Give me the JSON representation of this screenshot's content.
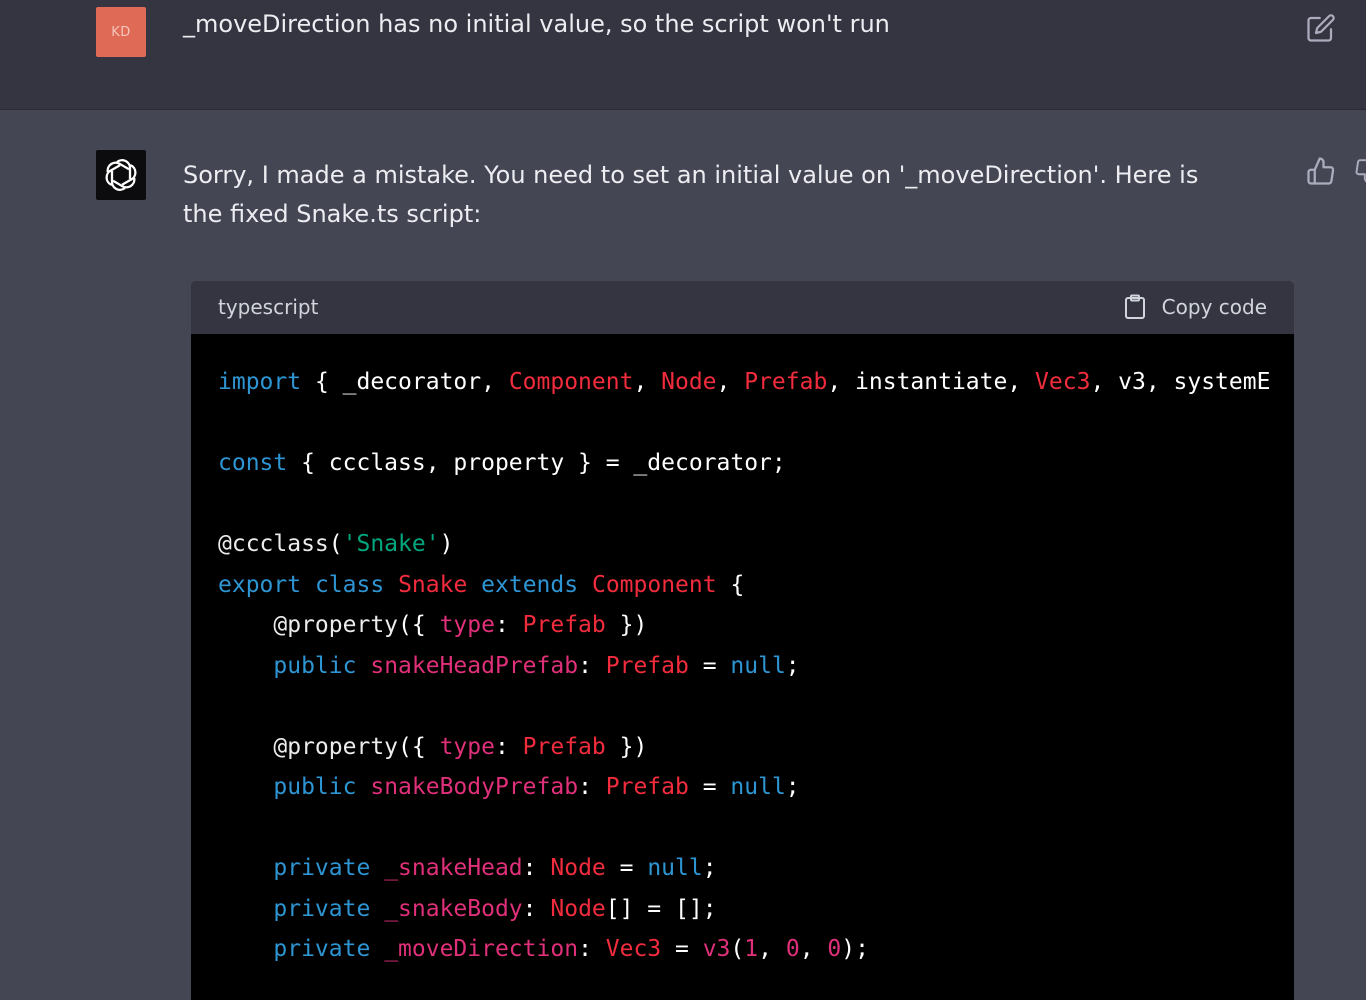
{
  "user_message": {
    "avatar_initials": "KD",
    "text": "_moveDirection has no initial value, so the script won't run"
  },
  "assistant_message": {
    "text": "Sorry, I made a mistake. You need to set an initial value on '_moveDirection'. Here is the fixed Snake.ts script:"
  },
  "code_block": {
    "language": "typescript",
    "copy_label": "Copy code",
    "lines": [
      [
        [
          "kw",
          "import"
        ],
        [
          "pl",
          " { _decorator, "
        ],
        [
          "ty",
          "Component"
        ],
        [
          "pl",
          ", "
        ],
        [
          "ty",
          "Node"
        ],
        [
          "pl",
          ", "
        ],
        [
          "ty",
          "Prefab"
        ],
        [
          "pl",
          ", instantiate, "
        ],
        [
          "ty",
          "Vec3"
        ],
        [
          "pl",
          ", v3, systemE"
        ]
      ],
      [],
      [
        [
          "kw",
          "const"
        ],
        [
          "pl",
          " { ccclass, property } = _decorator;"
        ]
      ],
      [],
      [
        [
          "dec",
          "@ccclass"
        ],
        [
          "pl",
          "("
        ],
        [
          "st",
          "'Snake'"
        ],
        [
          "pl",
          ")"
        ]
      ],
      [
        [
          "kw",
          "export"
        ],
        [
          "pl",
          " "
        ],
        [
          "kw",
          "class"
        ],
        [
          "pl",
          " "
        ],
        [
          "ty",
          "Snake"
        ],
        [
          "pl",
          " "
        ],
        [
          "kw",
          "extends"
        ],
        [
          "pl",
          " "
        ],
        [
          "ty",
          "Component"
        ],
        [
          "pl",
          " {"
        ]
      ],
      [
        [
          "pl",
          "    "
        ],
        [
          "dec",
          "@property"
        ],
        [
          "pl",
          "({ "
        ],
        [
          "nm",
          "type"
        ],
        [
          "pl",
          ": "
        ],
        [
          "ty",
          "Prefab"
        ],
        [
          "pl",
          " })"
        ]
      ],
      [
        [
          "pl",
          "    "
        ],
        [
          "kw",
          "public"
        ],
        [
          "pl",
          " "
        ],
        [
          "nm",
          "snakeHeadPrefab"
        ],
        [
          "pl",
          ": "
        ],
        [
          "ty",
          "Prefab"
        ],
        [
          "pl",
          " = "
        ],
        [
          "kw",
          "null"
        ],
        [
          "pl",
          ";"
        ]
      ],
      [],
      [
        [
          "pl",
          "    "
        ],
        [
          "dec",
          "@property"
        ],
        [
          "pl",
          "({ "
        ],
        [
          "nm",
          "type"
        ],
        [
          "pl",
          ": "
        ],
        [
          "ty",
          "Prefab"
        ],
        [
          "pl",
          " })"
        ]
      ],
      [
        [
          "pl",
          "    "
        ],
        [
          "kw",
          "public"
        ],
        [
          "pl",
          " "
        ],
        [
          "nm",
          "snakeBodyPrefab"
        ],
        [
          "pl",
          ": "
        ],
        [
          "ty",
          "Prefab"
        ],
        [
          "pl",
          " = "
        ],
        [
          "kw",
          "null"
        ],
        [
          "pl",
          ";"
        ]
      ],
      [],
      [
        [
          "pl",
          "    "
        ],
        [
          "kw",
          "private"
        ],
        [
          "pl",
          " "
        ],
        [
          "nm",
          "_snakeHead"
        ],
        [
          "pl",
          ": "
        ],
        [
          "ty",
          "Node"
        ],
        [
          "pl",
          " = "
        ],
        [
          "kw",
          "null"
        ],
        [
          "pl",
          ";"
        ]
      ],
      [
        [
          "pl",
          "    "
        ],
        [
          "kw",
          "private"
        ],
        [
          "pl",
          " "
        ],
        [
          "nm",
          "_snakeBody"
        ],
        [
          "pl",
          ": "
        ],
        [
          "ty",
          "Node"
        ],
        [
          "pl",
          "[] = [];"
        ]
      ],
      [
        [
          "pl",
          "    "
        ],
        [
          "kw",
          "private"
        ],
        [
          "pl",
          " "
        ],
        [
          "nm",
          "_moveDirection"
        ],
        [
          "pl",
          ": "
        ],
        [
          "ty",
          "Vec3"
        ],
        [
          "pl",
          " = "
        ],
        [
          "nm",
          "v3"
        ],
        [
          "pl",
          "("
        ],
        [
          "nm",
          "1"
        ],
        [
          "pl",
          ", "
        ],
        [
          "nm",
          "0"
        ],
        [
          "pl",
          ", "
        ],
        [
          "nm",
          "0"
        ],
        [
          "pl",
          ");"
        ]
      ]
    ]
  },
  "icons": {
    "edit": "edit-icon",
    "copy": "clipboard-icon",
    "thumbs_up": "thumbs-up-icon",
    "thumbs_down": "thumbs-down-icon",
    "assistant_logo": "openai-logo-icon"
  },
  "colors": {
    "keyword": "#2e95d3",
    "type": "#f22c3d",
    "string": "#00a67d",
    "name": "#df3079",
    "user_avatar": "#df6a55"
  }
}
